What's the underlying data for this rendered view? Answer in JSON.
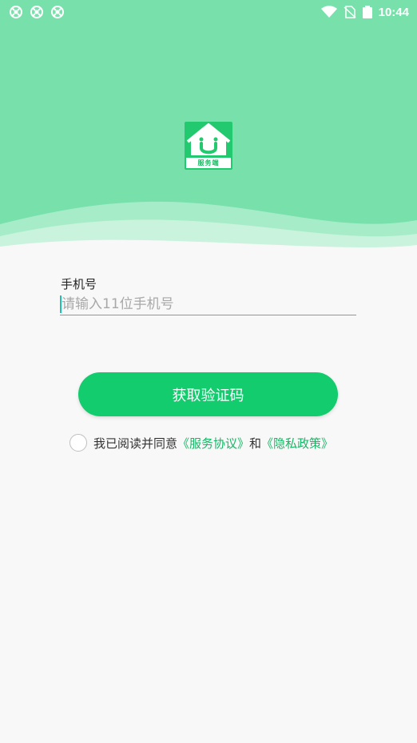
{
  "status_bar": {
    "time": "10:44",
    "left_icons": [
      "sync-icon",
      "sync-icon",
      "sync-icon"
    ],
    "right_icons": [
      "wifi-icon",
      "no-sim-icon",
      "battery-icon"
    ]
  },
  "logo": {
    "badge_text": "服务端"
  },
  "form": {
    "phone_label": "手机号",
    "phone_placeholder": "请输入11位手机号",
    "phone_value": ""
  },
  "actions": {
    "get_code_label": "获取验证码"
  },
  "agreement": {
    "prefix": "我已阅读并同意",
    "service_link": "《服务协议》",
    "connector": "和",
    "privacy_link": "《隐私政策》",
    "checked": false
  },
  "colors": {
    "header_green": "#78e0ab",
    "primary_green": "#12cc6e",
    "link_green": "#15b865"
  }
}
